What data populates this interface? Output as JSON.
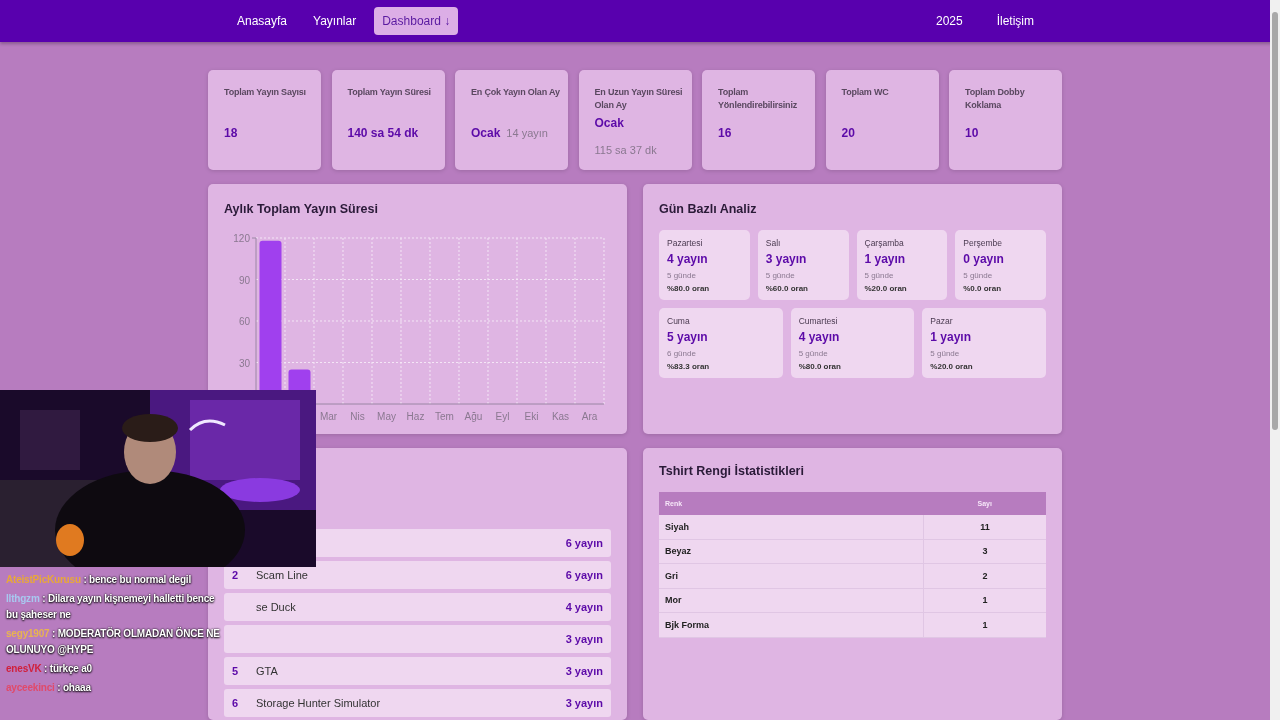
{
  "nav": {
    "left": [
      {
        "label": "Anasayfa",
        "selected": false
      },
      {
        "label": "Yayınlar",
        "selected": false
      },
      {
        "label": "Dashboard ↓",
        "selected": true
      }
    ],
    "right": [
      {
        "label": "2025"
      },
      {
        "label": "İletişim"
      }
    ]
  },
  "stats": [
    {
      "label": "Toplam Yayın Sayısı",
      "value": "18"
    },
    {
      "label": "Toplam Yayın Süresi",
      "value": "140 sa 54 dk"
    },
    {
      "label": "En Çok Yayın Olan Ay",
      "value": "Ocak",
      "note": "14 yayın",
      "kind": "inline"
    },
    {
      "label": "En Uzun Yayın Süresi Olan Ay",
      "value": "Ocak",
      "note": "115 sa 37 dk",
      "kind": "stacked"
    },
    {
      "label": "Toplam Yönlendirebilirsiniz",
      "value": "16"
    },
    {
      "label": "Toplam WC",
      "value": "20"
    },
    {
      "label": "Toplam Dobby Koklama",
      "value": "10"
    }
  ],
  "monthly": {
    "title": "Aylık Toplam Yayın Süresi",
    "chart_data": {
      "type": "bar",
      "grid": true,
      "categories": [
        null,
        null,
        "Mar",
        "Nis",
        "May",
        "Haz",
        "Tem",
        "Ağu",
        "Eyl",
        "Eki",
        "Kas",
        "Ara"
      ],
      "values": [
        118,
        25,
        0,
        0,
        0,
        0,
        0,
        0,
        0,
        0,
        0,
        0
      ],
      "ylim": [
        0,
        120
      ],
      "yticks": [
        30,
        60,
        90,
        120
      ]
    }
  },
  "days": {
    "title": "Gün Bazlı Analiz",
    "items": [
      {
        "day": "Pazartesi",
        "count": "4 yayın",
        "days": "5 günde",
        "ratio": "%80.0 oran"
      },
      {
        "day": "Salı",
        "count": "3 yayın",
        "days": "5 günde",
        "ratio": "%60.0 oran"
      },
      {
        "day": "Çarşamba",
        "count": "1 yayın",
        "days": "5 günde",
        "ratio": "%20.0 oran"
      },
      {
        "day": "Perşembe",
        "count": "0 yayın",
        "days": "5 günde",
        "ratio": "%0.0 oran"
      },
      {
        "day": "Cuma",
        "count": "5 yayın",
        "days": "6 günde",
        "ratio": "%83.3 oran"
      },
      {
        "day": "Cumartesi",
        "count": "4 yayın",
        "days": "5 günde",
        "ratio": "%80.0 oran"
      },
      {
        "day": "Pazar",
        "count": "1 yayın",
        "days": "5 günde",
        "ratio": "%20.0 oran"
      }
    ]
  },
  "games": [
    {
      "count": "6 yayın"
    },
    {
      "rank": "2",
      "name": "Scam Line",
      "count": "6 yayın"
    },
    {
      "name": "se Duck",
      "count": "4 yayın"
    },
    {
      "count": "3 yayın"
    },
    {
      "rank": "5",
      "name": "GTA",
      "count": "3 yayın"
    },
    {
      "rank": "6",
      "name": "Storage Hunter Simulator",
      "count": "3 yayın"
    }
  ],
  "shirts": {
    "title": "Tshirt Rengi İstatistikleri",
    "columns": [
      "Renk",
      "Sayı"
    ],
    "rows": [
      [
        "Siyah",
        "11"
      ],
      [
        "Beyaz",
        "3"
      ],
      [
        "Gri",
        "2"
      ],
      [
        "Mor",
        "1"
      ],
      [
        "Bjk Forma",
        "1"
      ]
    ]
  },
  "overlay": {
    "chat": [
      {
        "user": "AteistPicKurusu",
        "color": "#e8a838",
        "text": ": bence bu normal degil"
      },
      {
        "user": "llthgzm",
        "color": "#a8c8f0",
        "text": ": Dilara yayın kişnemeyi halletti bence bu şaheser ne"
      },
      {
        "user": "segy1907",
        "color": "#e8b450",
        "text": ": MODERATÖR OLMADAN ÖNCE NE OLUNUYO @HYPE"
      },
      {
        "user": "enesVK",
        "color": "#d0203c",
        "text": ": türkçe a0"
      },
      {
        "user": "ayceekinci",
        "color": "#e04a6a",
        "text": ": ohaaa"
      }
    ]
  }
}
